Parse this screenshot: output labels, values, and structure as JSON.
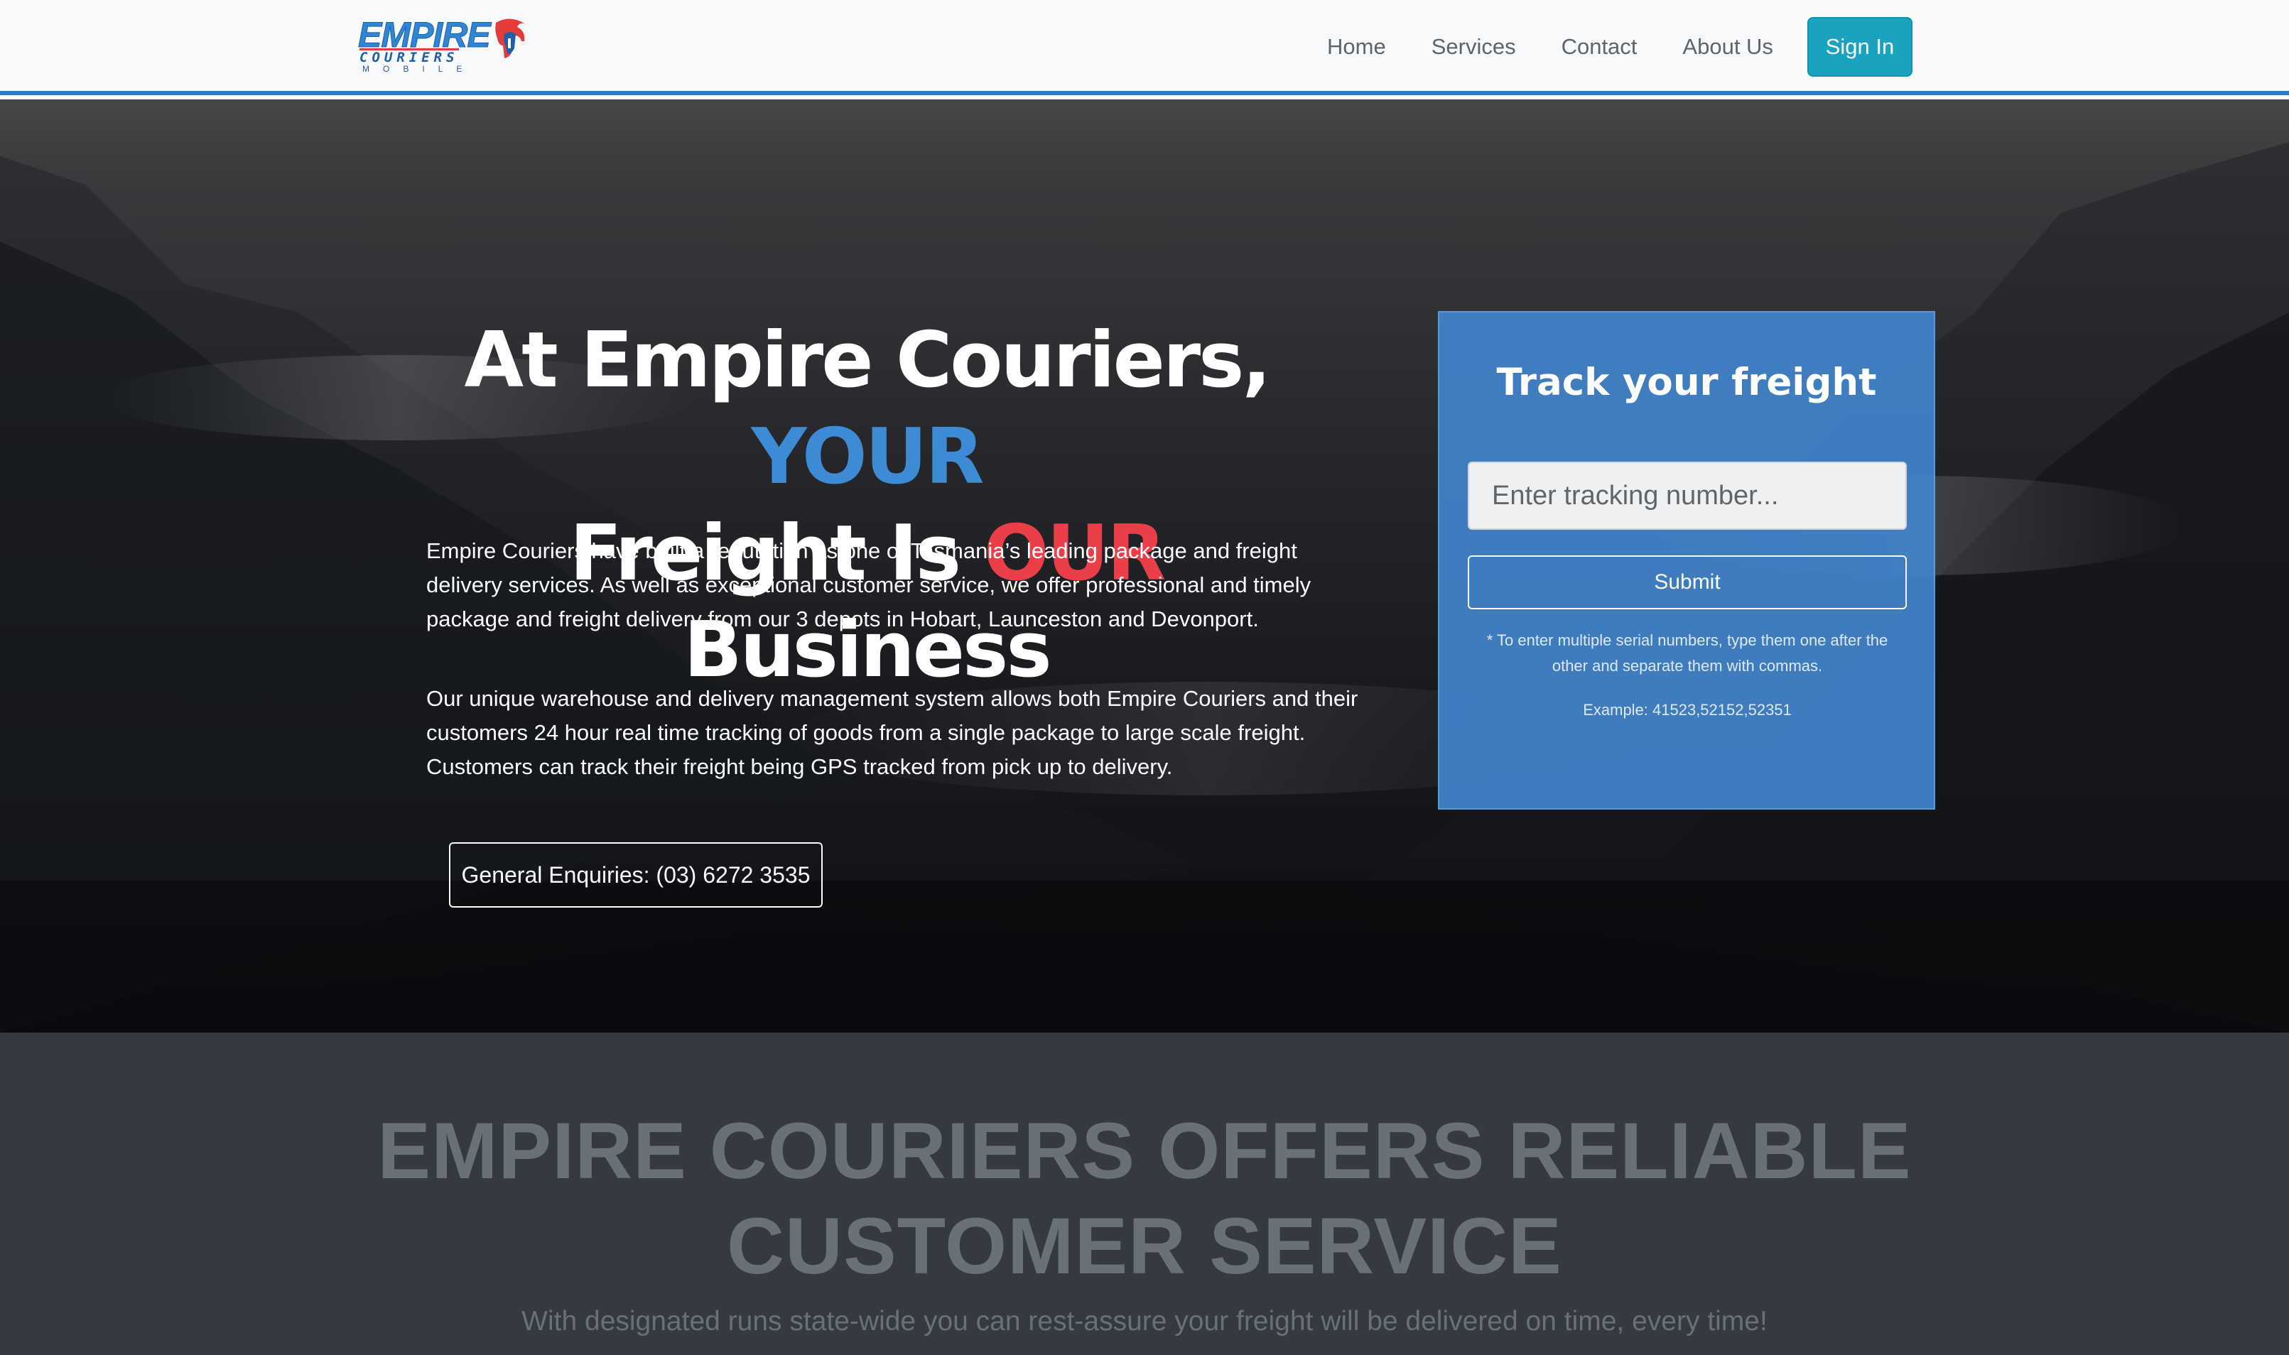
{
  "brand": {
    "logo_word": "EMPIRE",
    "logo_sub": "COURIERS",
    "logo_mobile": "MOBILE",
    "logo_icon": "spartan-helmet-icon",
    "colors": {
      "blue": "#2e86d4",
      "red": "#e53b3b"
    }
  },
  "nav": {
    "items": [
      "Home",
      "Services",
      "Contact",
      "About Us"
    ],
    "signin_label": "Sign In",
    "accent": "#1aa3bf"
  },
  "hero": {
    "title": {
      "part1": "At Empire Couriers, ",
      "highlight1": "YOUR",
      "part2": "Freight Is ",
      "highlight2": "OUR",
      "part3": " Business"
    },
    "paragraph1": "Empire Couriers have built a reputation as one of Tasmania’s leading package and freight delivery services. As well as exceptional customer service, we offer professional and timely package and freight delivery from our 3 depots in Hobart, Launceston and Devonport.",
    "paragraph2": "Our unique warehouse and delivery management system allows both Empire Couriers and their customers 24 hour real time tracking of goods from a single package to large scale freight. Customers can track their freight being GPS tracked from pick up to delivery.",
    "enquiry_button": "General Enquiries: (03) 6272 3535",
    "colors": {
      "highlight_blue": "#3d8bd4",
      "highlight_red": "#ea3f49"
    }
  },
  "tracking": {
    "title": "Track your freight",
    "input_placeholder": "Enter tracking number...",
    "input_value": "",
    "submit_label": "Submit",
    "note": "* To enter multiple serial numbers, type them one after the other and separate them with commas.",
    "example": "Example: 41523,52152,52351",
    "card_color": "#4284cc"
  },
  "section": {
    "title": "EMPIRE COURIERS OFFERS RELIABLE CUSTOMER SERVICE",
    "subtitle": "With designated runs state-wide you can rest-assure your freight will be delivered on time, every time!"
  }
}
